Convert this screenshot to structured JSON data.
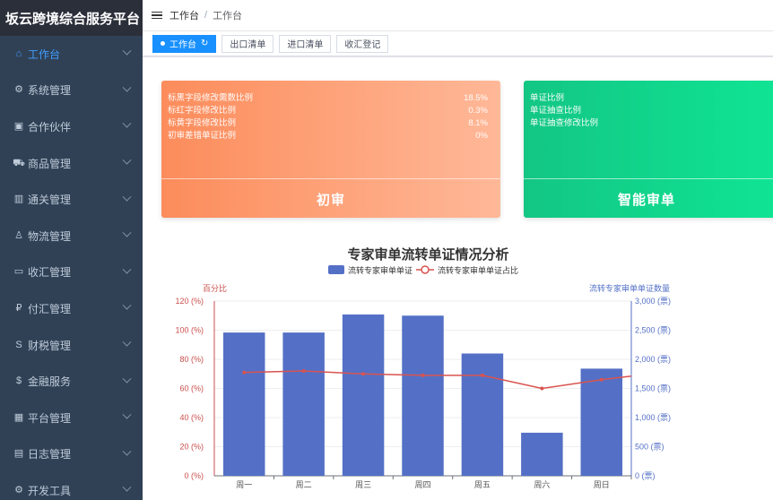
{
  "app": {
    "title": "坂云跨境综合服务平台"
  },
  "sidebar": {
    "items": [
      {
        "label": "工作台",
        "icon": "home-icon",
        "active": true
      },
      {
        "label": "系统管理",
        "icon": "gear-icon"
      },
      {
        "label": "合作伙伴",
        "icon": "partner-icon"
      },
      {
        "label": "商品管理",
        "icon": "cart-icon"
      },
      {
        "label": "通关管理",
        "icon": "customs-icon"
      },
      {
        "label": "物流管理",
        "icon": "user-icon"
      },
      {
        "label": "收汇管理",
        "icon": "card-icon"
      },
      {
        "label": "付汇管理",
        "icon": "ruble-icon"
      },
      {
        "label": "财税管理",
        "icon": "s-dollar-icon"
      },
      {
        "label": "金融服务",
        "icon": "dollar-icon"
      },
      {
        "label": "平台管理",
        "icon": "grid-icon"
      },
      {
        "label": "日志管理",
        "icon": "log-icon"
      },
      {
        "label": "开发工具",
        "icon": "tools-icon"
      }
    ]
  },
  "breadcrumb": [
    "工作台",
    "工作台"
  ],
  "tags": [
    {
      "label": "工作台",
      "active": true
    },
    {
      "label": "出口清单"
    },
    {
      "label": "进口清单"
    },
    {
      "label": "收汇登记"
    }
  ],
  "cards": [
    {
      "title": "初审",
      "rows": [
        {
          "label": "标黑字段修改需数比例",
          "value": "18.5%"
        },
        {
          "label": "标红字段修改比例",
          "value": "0.3%"
        },
        {
          "label": "标黄字段修改比例",
          "value": "8.1%"
        },
        {
          "label": "初审差错单证比例",
          "value": "0%"
        }
      ]
    },
    {
      "title": "智能审单",
      "rows": [
        {
          "label": "单证比例",
          "value": ""
        },
        {
          "label": "单证抽查比例",
          "value": ""
        },
        {
          "label": "单证抽查修改比例",
          "value": ""
        }
      ]
    }
  ],
  "colors": {
    "bar": "#5470c6",
    "line": "#d9534f",
    "left_axis": "#c9504c",
    "right_axis": "#5470c6",
    "sidebar": "#304156",
    "accent": "#409eff"
  },
  "chart_data": {
    "type": "bar",
    "title": "专家审单流转单证情况分析",
    "categories": [
      "周一",
      "周二",
      "周三",
      "周四",
      "周五",
      "周六",
      "周日"
    ],
    "series": [
      {
        "name": "流转专家审单单证",
        "type": "bar",
        "axis": "right",
        "values": [
          2460,
          2460,
          2770,
          2750,
          2100,
          740,
          1840
        ]
      },
      {
        "name": "流转专家审单单证占比",
        "type": "line",
        "axis": "left",
        "values": [
          71,
          72,
          70,
          69,
          69,
          60,
          66
        ]
      }
    ],
    "left_axis": {
      "name": "百分比",
      "ylim": [
        0,
        120
      ],
      "ticks": [
        "0 (%)",
        "20 (%)",
        "40 (%)",
        "60 (%)",
        "80 (%)",
        "100 (%)",
        "120 (%)"
      ]
    },
    "right_axis": {
      "name": "流转专家审单单证数量",
      "ylim": [
        0,
        3000
      ],
      "ticks": [
        "0 (票)",
        "500 (票)",
        "1,000 (票)",
        "1,500 (票)",
        "2,000 (票)",
        "2,500 (票)",
        "3,000 (票)"
      ]
    },
    "legend": "top-center",
    "grid": true
  }
}
